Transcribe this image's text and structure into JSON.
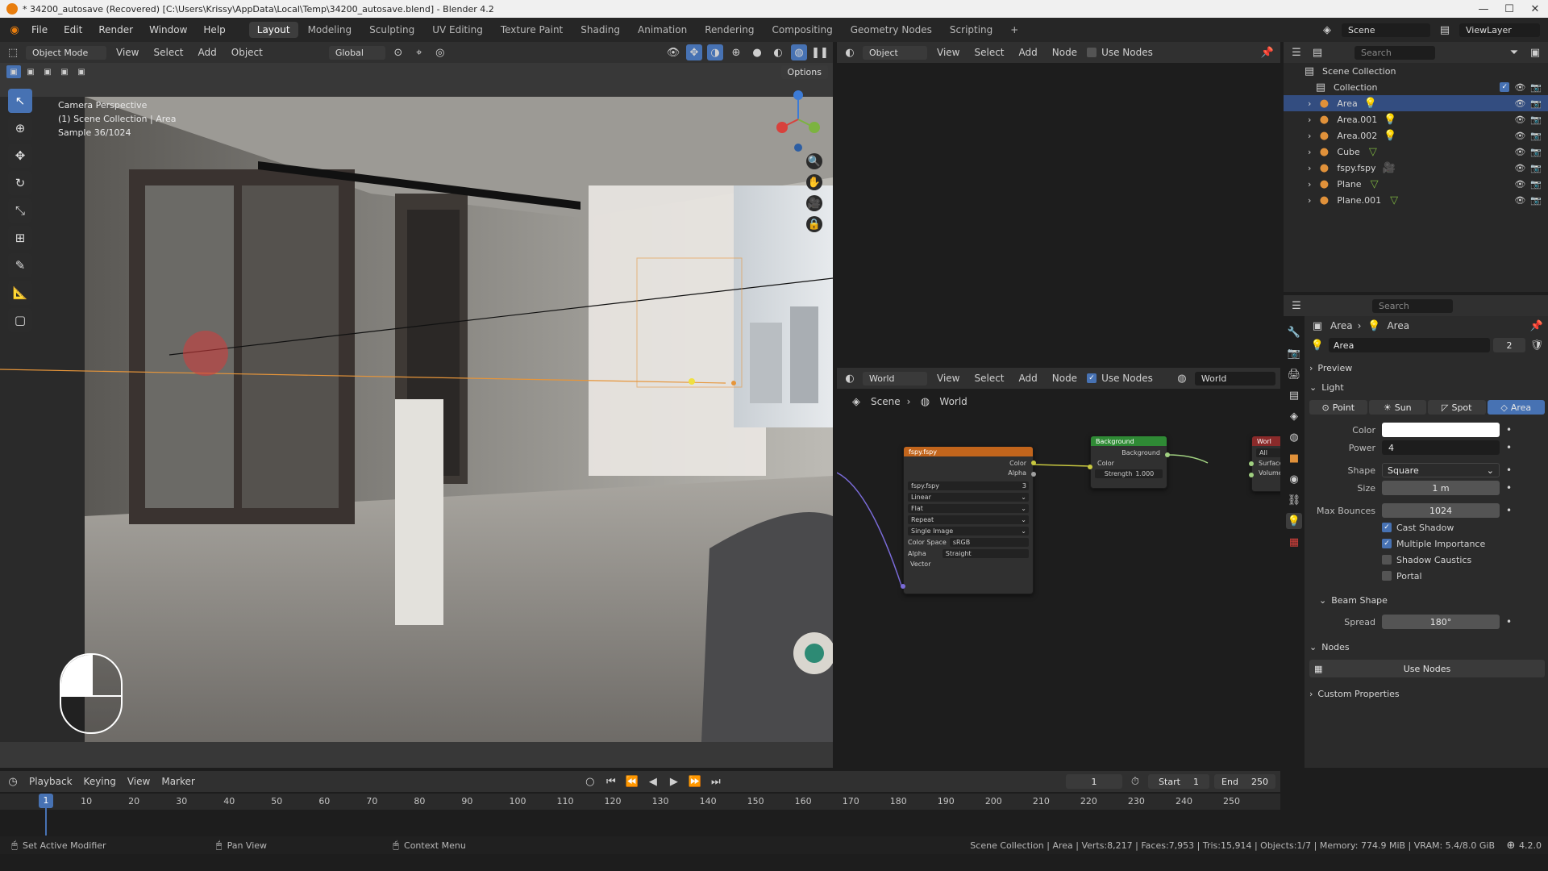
{
  "titlebar": {
    "title": "* 34200_autosave (Recovered) [C:\\Users\\Krissy\\AppData\\Local\\Temp\\34200_autosave.blend] - Blender 4.2"
  },
  "menus": [
    "File",
    "Edit",
    "Render",
    "Window",
    "Help"
  ],
  "workspaces": [
    "Layout",
    "Modeling",
    "Sculpting",
    "UV Editing",
    "Texture Paint",
    "Shading",
    "Animation",
    "Rendering",
    "Compositing",
    "Geometry Nodes",
    "Scripting"
  ],
  "scene": {
    "name": "Scene",
    "view_layer": "ViewLayer"
  },
  "viewport": {
    "mode": "Object Mode",
    "menus": [
      "View",
      "Select",
      "Add",
      "Object"
    ],
    "transform": "Global",
    "options": "Options",
    "overlay_lines": [
      "Camera Perspective",
      "(1) Scene Collection | Area",
      "Sample 36/1024"
    ]
  },
  "shader_editor_top": {
    "type": "Object",
    "menus": [
      "View",
      "Select",
      "Add",
      "Node"
    ],
    "use_nodes": "Use Nodes"
  },
  "world_editor": {
    "type": "World",
    "menus": [
      "View",
      "Select",
      "Add",
      "Node"
    ],
    "use_nodes": "Use Nodes",
    "world": "World",
    "breadcrumb": [
      "Scene",
      "World"
    ]
  },
  "nodes": {
    "image": {
      "title": "fspy.fspy",
      "outputs": [
        "Color",
        "Alpha"
      ],
      "image": "fspy.fspy",
      "users": "3",
      "interp": "Linear",
      "proj": "Flat",
      "ext": "Repeat",
      "source": "Single Image",
      "colorspace_label": "Color Space",
      "colorspace": "sRGB",
      "alpha_label": "Alpha",
      "alpha": "Straight",
      "input": "Vector"
    },
    "background": {
      "title": "Background",
      "output": "Background",
      "input": "Color",
      "strength_label": "Strength",
      "strength": "1.000"
    },
    "output": {
      "title": "Worl",
      "target": "All",
      "inputs": [
        "Surface",
        "Volume"
      ]
    }
  },
  "outliner": {
    "search": "Search",
    "root": "Scene Collection",
    "collection": "Collection",
    "items": [
      {
        "name": "Area",
        "icon": "light-icon",
        "selected": true
      },
      {
        "name": "Area.001",
        "icon": "light-icon",
        "selected": false
      },
      {
        "name": "Area.002",
        "icon": "light-icon",
        "selected": false
      },
      {
        "name": "Cube",
        "icon": "mesh-icon",
        "selected": false
      },
      {
        "name": "fspy.fspy",
        "icon": "camera-icon",
        "selected": false
      },
      {
        "name": "Plane",
        "icon": "mesh-icon",
        "selected": false
      },
      {
        "name": "Plane.001",
        "icon": "mesh-icon",
        "selected": false
      }
    ]
  },
  "properties": {
    "search": "Search",
    "breadcrumb": [
      "Area",
      "Area"
    ],
    "datablock": "Area",
    "users": "2",
    "preview": "Preview",
    "light": "Light",
    "light_types": [
      "Point",
      "Sun",
      "Spot",
      "Area"
    ],
    "color_label": "Color",
    "power_label": "Power",
    "power": "4",
    "shape_label": "Shape",
    "shape": "Square",
    "size_label": "Size",
    "size": "1 m",
    "bounces_label": "Max Bounces",
    "bounces": "1024",
    "checks": [
      {
        "label": "Cast Shadow",
        "on": true
      },
      {
        "label": "Multiple Importance",
        "on": true
      },
      {
        "label": "Shadow Caustics",
        "on": false
      },
      {
        "label": "Portal",
        "on": false
      }
    ],
    "beam": "Beam Shape",
    "spread_label": "Spread",
    "spread": "180°",
    "nodes": "Nodes",
    "use_nodes": "Use Nodes",
    "custom": "Custom Properties"
  },
  "timeline": {
    "menus": [
      "Playback",
      "Keying",
      "View",
      "Marker"
    ],
    "current": "1",
    "start_label": "Start",
    "start": "1",
    "end_label": "End",
    "end": "250",
    "ticks": [
      "1",
      "10",
      "20",
      "30",
      "40",
      "50",
      "60",
      "70",
      "80",
      "90",
      "100",
      "110",
      "120",
      "130",
      "140",
      "150",
      "160",
      "170",
      "180",
      "190",
      "200",
      "210",
      "220",
      "230",
      "240",
      "250"
    ]
  },
  "status": {
    "left": [
      "Set Active Modifier",
      "Pan View",
      "Context Menu"
    ],
    "right": "Scene Collection | Area | Verts:8,217 | Faces:7,953 | Tris:15,914 | Objects:1/7 | Memory: 774.9 MiB | VRAM: 5.4/8.0 GiB",
    "version": "4.2.0"
  },
  "colors": {
    "accent": "#4772b3",
    "selected_row": "#334d80",
    "image_node": "#c2651c",
    "bg_node": "#2f8a35",
    "output_node": "#8a2a2a"
  }
}
